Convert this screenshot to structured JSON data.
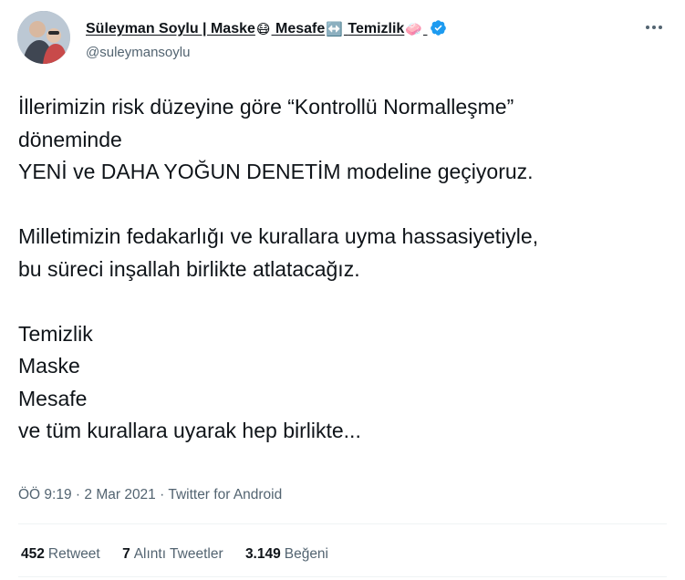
{
  "author": {
    "name_parts": [
      "Süleyman Soylu | Maske",
      "Mesafe",
      "Temizlik"
    ],
    "emojis": [
      "😷",
      "↔️",
      "🧼"
    ],
    "handle": "@suleymansoylu",
    "verified": true
  },
  "tweet": {
    "paragraphs": [
      [
        "İllerimizin risk düzeyine göre “Kontrollü Normalleşme”",
        "döneminde",
        "YENİ ve DAHA YOĞUN DENETİM modeline geçiyoruz."
      ],
      [
        "Milletimizin fedakarlığı ve kurallara uyma hassasiyetiyle,",
        "bu süreci inşallah birlikte atlatacağız."
      ],
      [
        "Temizlik",
        "Maske",
        "Mesafe",
        "ve tüm kurallara uyarak hep birlikte..."
      ]
    ],
    "time": "ÖÖ 9:19",
    "separator": "·",
    "date": "2 Mar 2021",
    "source": "Twitter for Android"
  },
  "stats": {
    "retweets_count": "452",
    "retweets_label": "Retweet",
    "quotes_count": "7",
    "quotes_label": "Alıntı Tweetler",
    "likes_count": "3.149",
    "likes_label": "Beğeni"
  },
  "colors": {
    "text": "#0f1419",
    "muted": "#536471",
    "verified": "#1d9bf0",
    "divider": "#eff3f4"
  },
  "icons": [
    "verified-badge-icon",
    "more-options-icon"
  ]
}
